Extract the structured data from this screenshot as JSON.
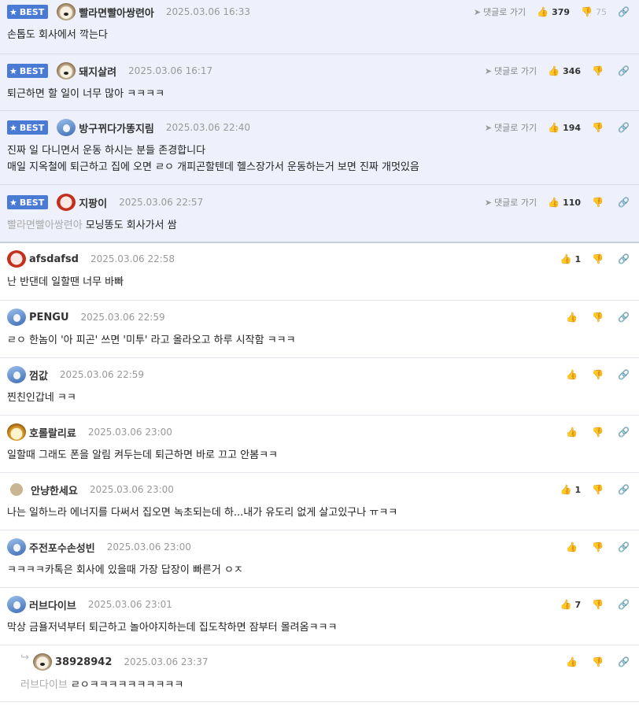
{
  "badge_label": "BEST",
  "goto_label": "댓글로 가기",
  "best": [
    {
      "nick": "빨라면빨아쌍련아",
      "date": "2025.03.06 16:33",
      "up": "379",
      "down": "75",
      "avatar": "dog",
      "lines": [
        "손톱도 회사에서 깍는다"
      ],
      "mention": ""
    },
    {
      "nick": "돼지살려",
      "date": "2025.03.06 16:17",
      "up": "346",
      "down": "",
      "avatar": "dog",
      "lines": [
        "퇴근하면 할 일이 너무 많아 ㅋㅋㅋㅋ"
      ],
      "mention": ""
    },
    {
      "nick": "방구뀌다가똥지림",
      "date": "2025.03.06 22:40",
      "up": "194",
      "down": "",
      "avatar": "bird",
      "lines": [
        "진짜 일 다니면서 운동 하시는 분들 존경합니다",
        "매일 지옥철에 퇴근하고 집에 오면 ㄹㅇ 개피곤할텐데 헬스장가서 운동하는거 보면 진짜 개멋있음"
      ],
      "mention": ""
    },
    {
      "nick": "지팡이",
      "date": "2025.03.06 22:57",
      "up": "110",
      "down": "",
      "avatar": "redface",
      "lines": [
        "모닝똥도 회사가서 쌈"
      ],
      "mention": "빨라면빨아쌍련아"
    }
  ],
  "comments": [
    {
      "nick": "afsdafsd",
      "date": "2025.03.06 22:58",
      "up": "1",
      "avatar": "redface",
      "text": "난 반댄데 일할땐 너무 바빠"
    },
    {
      "nick": "PENGU",
      "date": "2025.03.06 22:59",
      "up": "",
      "avatar": "bird",
      "text": "ㄹㅇ 한놈이 '아 피곤' 쓰면 '미투' 라고 올라오고 하루 시작함 ㅋㅋㅋ"
    },
    {
      "nick": "껌값",
      "date": "2025.03.06 22:59",
      "up": "",
      "avatar": "bird",
      "text": "찐친인갑네 ㅋㅋ"
    },
    {
      "nick": "호롤랄리료",
      "date": "2025.03.06 23:00",
      "up": "",
      "avatar": "fox",
      "text": "일할때 그래도 폰을 알림 켜두는데 퇴근하면 바로 끄고 안봄ㅋㅋ"
    },
    {
      "nick": "안냥한세요",
      "date": "2025.03.06 23:00",
      "up": "1",
      "avatar": "ball",
      "text": "나는 일하느라 에너지를 다써서 집오면 녹초되는데 하...내가 유도리 없게 살고있구나 ㅠㅋㅋ"
    },
    {
      "nick": "주전포수손성빈",
      "date": "2025.03.06 23:00",
      "up": "",
      "avatar": "bird",
      "text": "ㅋㅋㅋㅋ카톡은 회사에 있을때 가장 답장이 빠른거 ㅇㅈ"
    },
    {
      "nick": "러브다이브",
      "date": "2025.03.06 23:01",
      "up": "7",
      "avatar": "bird",
      "text": "막상 금욜저녁부터 퇴근하고 놀아야지하는데 집도착하면 잠부터 몰려옴ㅋㅋㅋ"
    }
  ],
  "reply": {
    "nick": "38928942",
    "date": "2025.03.06 23:37",
    "up": "",
    "avatar": "dog",
    "mention": "러브다이브",
    "text": "ㄹㅇㅋㅋㅋㅋㅋㅋㅋㅋㅋㅋ"
  }
}
